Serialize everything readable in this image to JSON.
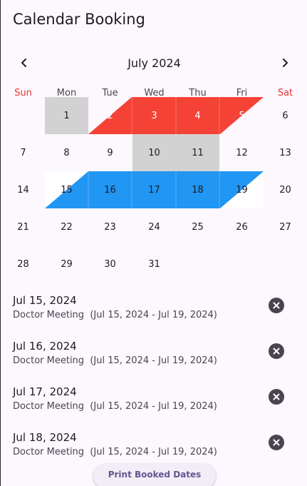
{
  "app": {
    "title": "Calendar Booking"
  },
  "calendar": {
    "month_label": "July 2024",
    "weekdays": [
      "Sun",
      "Mon",
      "Tue",
      "Wed",
      "Thu",
      "Fri",
      "Sat"
    ],
    "weeks": [
      [
        "",
        "1",
        "2",
        "3",
        "4",
        "5",
        "6"
      ],
      [
        "7",
        "8",
        "9",
        "10",
        "11",
        "12",
        "13"
      ],
      [
        "14",
        "15",
        "16",
        "17",
        "18",
        "19",
        "20"
      ],
      [
        "21",
        "22",
        "23",
        "24",
        "25",
        "26",
        "27"
      ],
      [
        "28",
        "29",
        "30",
        "31",
        "",
        "",
        ""
      ]
    ],
    "highlighted_grey": [
      "1",
      "10",
      "11"
    ],
    "booking_red": {
      "color": "#f44336",
      "days": [
        "2",
        "3",
        "4",
        "5"
      ]
    },
    "booking_blue": {
      "color": "#2196f3",
      "days": [
        "15",
        "16",
        "17",
        "18",
        "19"
      ]
    },
    "weekend_color": "#e53935"
  },
  "bookings": [
    {
      "date": "Jul 15, 2024",
      "title": "Doctor Meeting",
      "range": "(Jul 15, 2024 - Jul 19, 2024)"
    },
    {
      "date": "Jul 16, 2024",
      "title": "Doctor Meeting",
      "range": "(Jul 15, 2024 - Jul 19, 2024)"
    },
    {
      "date": "Jul 17, 2024",
      "title": "Doctor Meeting",
      "range": "(Jul 15, 2024 - Jul 19, 2024)"
    },
    {
      "date": "Jul 18, 2024",
      "title": "Doctor Meeting",
      "range": "(Jul 15, 2024 - Jul 19, 2024)"
    }
  ],
  "icons": {
    "prev": "chevron-left-icon",
    "next": "chevron-right-icon",
    "remove": "cancel-circle-icon"
  },
  "actions": {
    "print_label": "Print Booked Dates"
  }
}
